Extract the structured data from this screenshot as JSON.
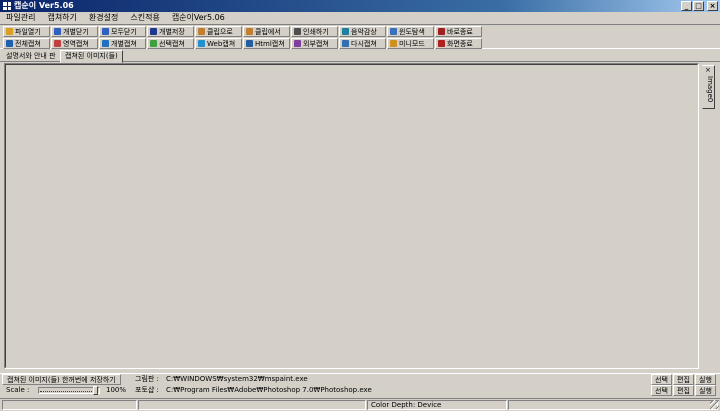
{
  "window": {
    "title": "캡순이 Ver5.06",
    "controls": [
      "_",
      "□",
      "×"
    ]
  },
  "menu": [
    "파일관리",
    "캡쳐하기",
    "환경설정",
    "스킨적용",
    "캡순이Ver5.06"
  ],
  "toolbar": {
    "row1": [
      {
        "label": "파일열기",
        "icon": "folder-open-icon"
      },
      {
        "label": "개별닫기",
        "icon": "close-single-icon"
      },
      {
        "label": "모두닫기",
        "icon": "close-all-icon"
      },
      {
        "label": "개별저장",
        "icon": "save-icon"
      },
      {
        "label": "클립으로",
        "icon": "clipboard-copy-icon"
      },
      {
        "label": "클립에서",
        "icon": "clipboard-paste-icon"
      },
      {
        "label": "인쇄하기",
        "icon": "printer-icon"
      },
      {
        "label": "음악감상",
        "icon": "music-icon"
      },
      {
        "label": "윈도탐색",
        "icon": "explorer-icon"
      },
      {
        "label": "바로종료",
        "icon": "exit-icon"
      }
    ],
    "row2": [
      {
        "label": "전체캡쳐",
        "icon": "fullscreen-capture-icon"
      },
      {
        "label": "영역캡쳐",
        "icon": "region-capture-icon"
      },
      {
        "label": "개별캡쳐",
        "icon": "window-capture-icon"
      },
      {
        "label": "선택캡쳐",
        "icon": "selection-capture-icon"
      },
      {
        "label": "Web캡쳐",
        "icon": "web-capture-icon"
      },
      {
        "label": "Html캡쳐",
        "icon": "html-capture-icon"
      },
      {
        "label": "외부캡쳐",
        "icon": "external-capture-icon"
      },
      {
        "label": "다시캡쳐",
        "icon": "recapture-icon"
      },
      {
        "label": "미니모드",
        "icon": "minimode-icon"
      },
      {
        "label": "화면종료",
        "icon": "screen-exit-icon"
      }
    ]
  },
  "tabs": [
    "설명서와 안내 판",
    "캡쳐된 이미지(들)"
  ],
  "side_panel": {
    "close": "×",
    "label": "Image0"
  },
  "status": {
    "save_button": "캡쳐된 이미지(들) 한꺼번에 저장하기",
    "paint_label": "그림판 :",
    "paint_path": "C:₩WINDOWS₩system32₩mspaint.exe",
    "photoshop_label": "포토샵 :",
    "photoshop_path": "C:₩Program Files₩Adobe₩Photoshop 7.0₩Photoshop.exe",
    "select_label": "선택",
    "edit_label": "편집",
    "run_label": "실행",
    "scale_label": "Scale :",
    "scale_value": "100%",
    "scale_fraction": 1.0,
    "color_depth": "Color Depth: Device"
  },
  "colors": {
    "titlebar_start": "#0a246a",
    "titlebar_end": "#a6caf0",
    "face": "#d4d0c8"
  }
}
